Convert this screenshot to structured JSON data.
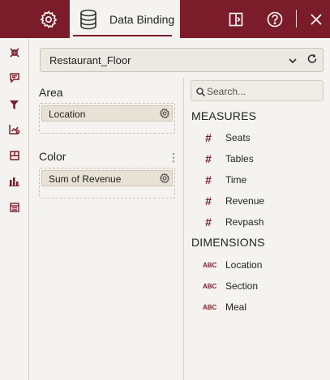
{
  "toolbar": {
    "active_tab_label": "Data Binding",
    "settings_icon": "gear-icon",
    "database_icon": "database-icon",
    "panel_icon": "panel-toggle-icon",
    "help_icon": "help-icon",
    "close_icon": "close-icon"
  },
  "sidebar": {
    "icons": [
      "collapse-arrows-icon",
      "comment-icon",
      "filter-icon",
      "chart-settings-icon",
      "table-layout-icon",
      "bar-chart-icon",
      "data-table-icon"
    ]
  },
  "dataset": {
    "selected": "Restaurant_Floor"
  },
  "bindings": {
    "area": {
      "title": "Area",
      "field": "Location"
    },
    "color": {
      "title": "Color",
      "field": "Sum of Revenue"
    }
  },
  "search": {
    "placeholder": "Search..."
  },
  "measures": {
    "title": "MEASURES",
    "items": [
      "Seats",
      "Tables",
      "Time",
      "Revenue",
      "Revpash"
    ]
  },
  "dimensions": {
    "title": "DIMENSIONS",
    "type_label": "ABC",
    "items": [
      "Location",
      "Section",
      "Meal"
    ]
  },
  "colors": {
    "accent": "#7b1c2a",
    "background": "#f5f3ef"
  }
}
